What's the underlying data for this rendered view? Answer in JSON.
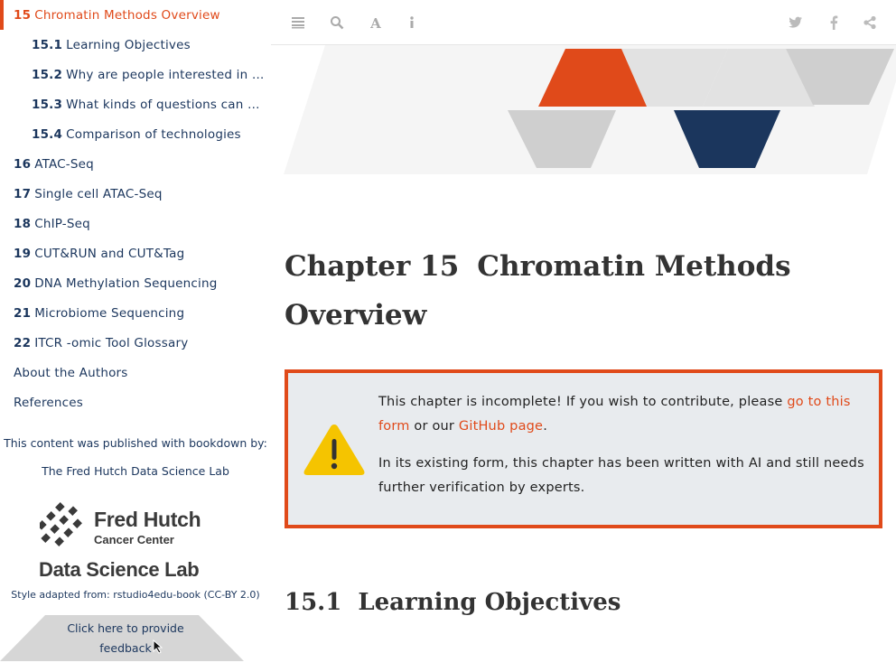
{
  "toc": [
    {
      "num": "15",
      "text": "Chromatin Methods Overview",
      "level": 1,
      "active": true
    },
    {
      "num": "15.1",
      "text": "Learning Objectives",
      "level": 2
    },
    {
      "num": "15.2",
      "text": "Why are people interested in chr…",
      "level": 2
    },
    {
      "num": "15.3",
      "text": "What kinds of questions can chr…",
      "level": 2
    },
    {
      "num": "15.4",
      "text": "Comparison of technologies",
      "level": 2
    },
    {
      "num": "16",
      "text": "ATAC-Seq",
      "level": 1
    },
    {
      "num": "17",
      "text": "Single cell ATAC-Seq",
      "level": 1
    },
    {
      "num": "18",
      "text": "ChIP-Seq",
      "level": 1
    },
    {
      "num": "19",
      "text": "CUT&RUN and CUT&Tag",
      "level": 1
    },
    {
      "num": "20",
      "text": "DNA Methylation Sequencing",
      "level": 1
    },
    {
      "num": "21",
      "text": "Microbiome Sequencing",
      "level": 1
    },
    {
      "num": "22",
      "text": "ITCR -omic Tool Glossary",
      "level": 1
    },
    {
      "num": "",
      "text": "About the Authors",
      "level": 1
    },
    {
      "num": "",
      "text": "References",
      "level": 1
    }
  ],
  "sidebar": {
    "published_text": "This content was published with bookdown by:",
    "publisher_link": "The Fred Hutch Data Science Lab",
    "logo": {
      "name": "Fred Hutch",
      "sub": "Cancer Center",
      "lab": "Data Science Lab"
    },
    "style_adapted": "Style adapted from: rstudio4edu-book (CC-BY 2.0)",
    "feedback": "Click here to provide feedback"
  },
  "toolbar": {
    "left_icons": [
      "menu-icon",
      "search-icon",
      "font-icon",
      "info-icon"
    ],
    "right_icons": [
      "twitter-icon",
      "facebook-icon",
      "share-icon"
    ]
  },
  "colors": {
    "accent": "#e04a1a",
    "navy": "#1b365d",
    "callout_bg": "#e8ebee",
    "banner_gray": "#cfcfcf"
  },
  "main": {
    "chapter_label": "Chapter 15",
    "chapter_title": "Chromatin Methods Overview",
    "callout": {
      "icon": "warning-icon",
      "p1_before": "This chapter is incomplete! If you wish to contribute, please ",
      "p1_link1": "go to this form",
      "p1_middle": " or our ",
      "p1_link2": "GitHub page",
      "p1_after": ".",
      "p2": "In its existing form, this chapter has been written with AI and still needs further verification by experts."
    },
    "section_num": "15.1",
    "section_title": "Learning Objectives"
  }
}
